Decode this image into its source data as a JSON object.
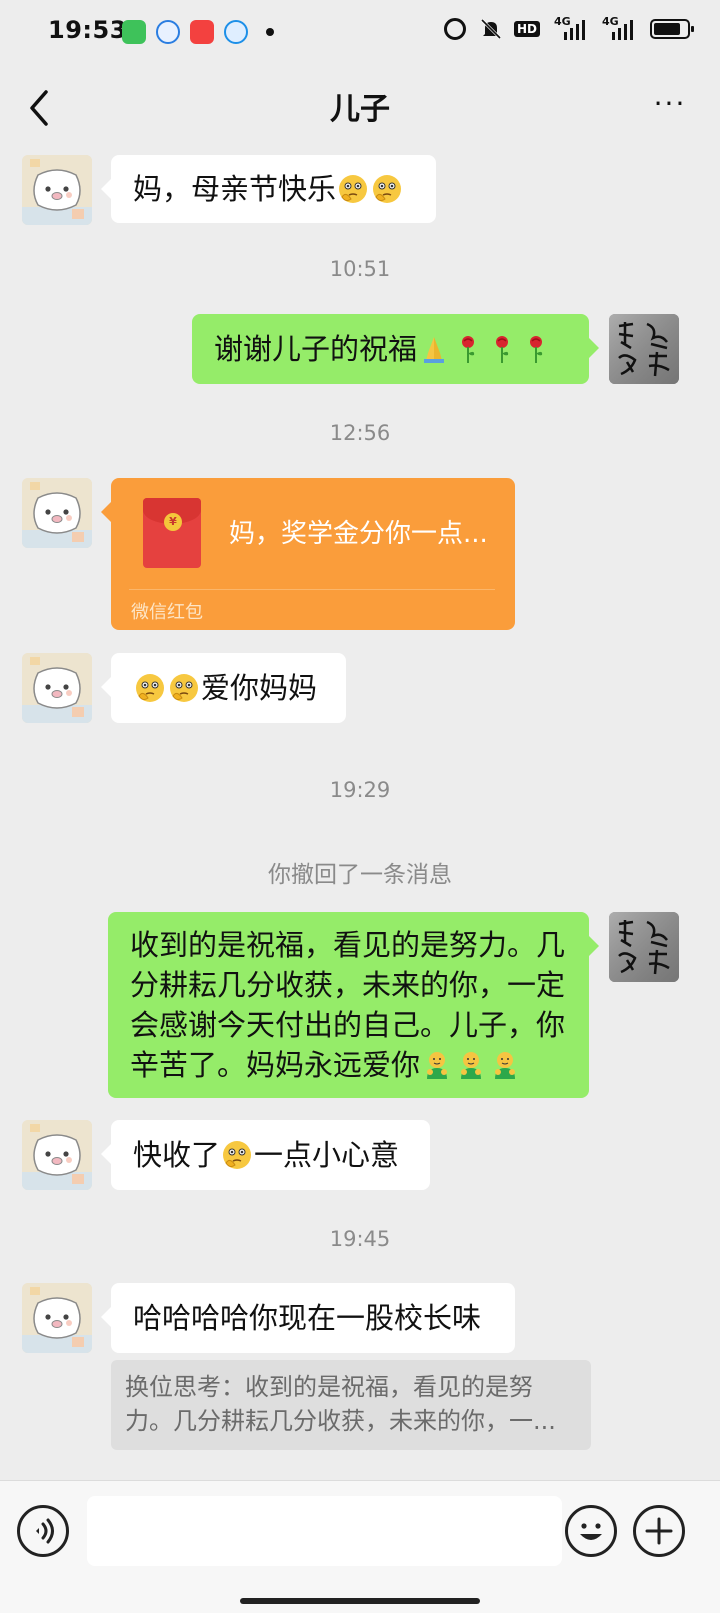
{
  "status_bar": {
    "time": "19:53",
    "hd_badge": "HD",
    "signal_1": "4G",
    "signal_2": "4G",
    "battery_level": 0.8
  },
  "nav": {
    "title": "儿子",
    "more_label": "···"
  },
  "messages": {
    "m1": {
      "text": "妈，母亲节快乐"
    },
    "ts1": "10:51",
    "m2": {
      "text": "谢谢儿子的祝福"
    },
    "ts2": "12:56",
    "red_packet": {
      "text": "妈，奖学金分你一点...",
      "footer": "微信红包",
      "symbol": "¥"
    },
    "m3": {
      "text": "爱你妈妈"
    },
    "ts3": "19:29",
    "recall": "你撤回了一条消息",
    "m4": {
      "text": "收到的是祝福，看见的是努力。几分耕耘几分收获，未来的你，一定会感谢今天付出的自己。儿子，你辛苦了。妈妈永远爱你"
    },
    "m5": {
      "pre": "快收了",
      "post": "一点小心意"
    },
    "ts4": "19:45",
    "m6": {
      "text": "哈哈哈哈你现在一股校长味"
    },
    "quote": {
      "text": "换位思考：收到的是祝福，看见的是努力。几分耕耘几分收获，未来的你，一..."
    }
  },
  "icons": {
    "back": "chevron-left-icon",
    "more": "more-dots-icon",
    "voice": "voice-icon",
    "emoji": "emoji-icon",
    "add": "plus-icon"
  },
  "colors": {
    "outgoing_bubble": "#95ec69",
    "incoming_bubble": "#ffffff",
    "red_packet": "#fa9d3b",
    "background": "#ededed"
  }
}
